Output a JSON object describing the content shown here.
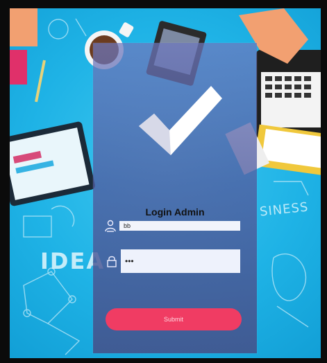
{
  "login": {
    "title": "Login Admin",
    "username_value": "bb",
    "password_value": "•••",
    "submit_label": "Submit"
  },
  "background": {
    "text_idea": "IDEA",
    "text_business": "SINESS"
  },
  "icons": {
    "checkmark": "checkmark-icon",
    "user": "user-icon",
    "lock": "lock-icon"
  },
  "colors": {
    "background_blue": "#1fb3e6",
    "card": "#5c66a8",
    "submit": "#f03c63"
  }
}
